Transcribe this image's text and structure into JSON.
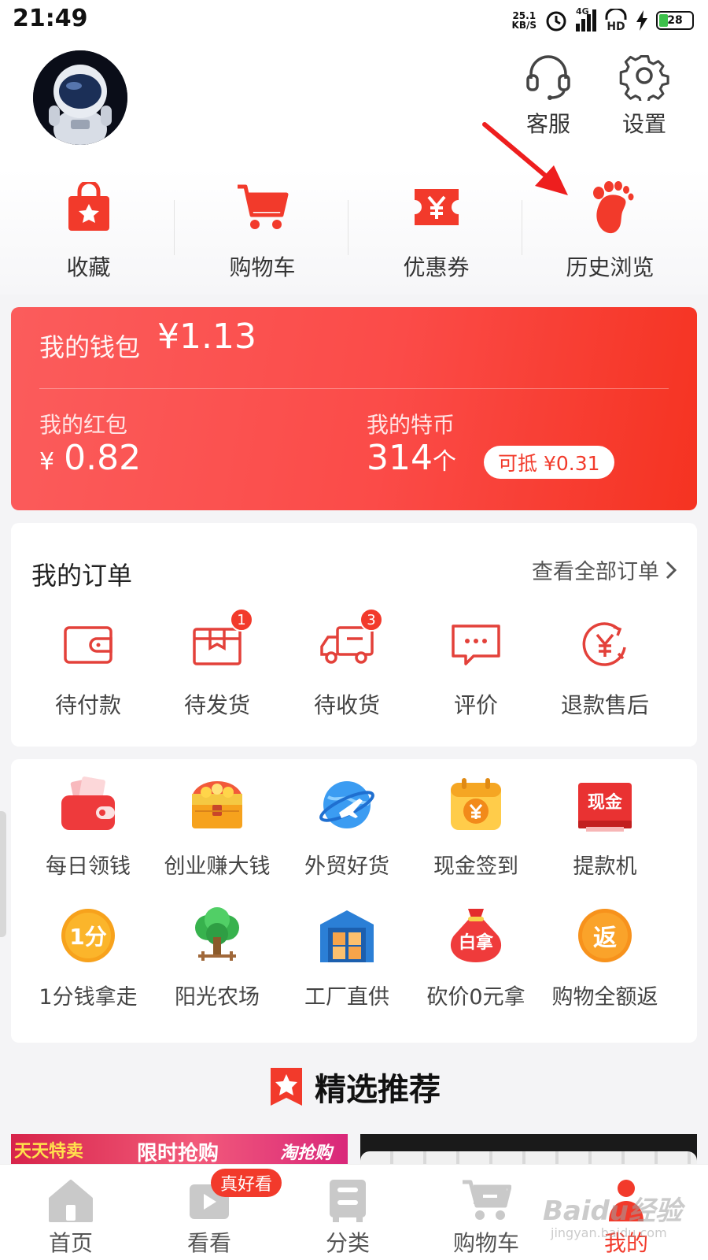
{
  "status_bar": {
    "time": "21:49",
    "net_speed_value": "25.1",
    "net_speed_unit": "KB/S",
    "network": "4G",
    "hd": "HD",
    "battery": "28",
    "battery_level": 0.28
  },
  "header": {
    "actions": [
      {
        "label": "客服",
        "icon": "headset-icon"
      },
      {
        "label": "设置",
        "icon": "gear-icon"
      }
    ]
  },
  "quick_links": [
    {
      "label": "收藏",
      "icon": "favorite-bag-icon"
    },
    {
      "label": "购物车",
      "icon": "cart-icon"
    },
    {
      "label": "优惠券",
      "icon": "coupon-icon"
    },
    {
      "label": "历史浏览",
      "icon": "footprint-icon"
    }
  ],
  "wallet": {
    "title": "我的钱包",
    "total": "¥1.13",
    "red_packet_label": "我的红包",
    "red_packet_currency": "¥",
    "red_packet_value": "0.82",
    "coin_label": "我的特币",
    "coin_value": "314",
    "coin_unit": "个",
    "coin_offset": "可抵 ¥0.31"
  },
  "orders": {
    "title": "我的订单",
    "view_all": "查看全部订单",
    "items": [
      {
        "label": "待付款",
        "icon": "wallet-icon",
        "badge": ""
      },
      {
        "label": "待发货",
        "icon": "package-icon",
        "badge": "1"
      },
      {
        "label": "待收货",
        "icon": "truck-icon",
        "badge": "3"
      },
      {
        "label": "评价",
        "icon": "comment-icon",
        "badge": ""
      },
      {
        "label": "退款售后",
        "icon": "refund-icon",
        "badge": ""
      }
    ]
  },
  "services": [
    {
      "label": "每日领钱",
      "icon": "red-wallet-icon"
    },
    {
      "label": "创业赚大钱",
      "icon": "treasure-chest-icon"
    },
    {
      "label": "外贸好货",
      "icon": "globe-plane-icon"
    },
    {
      "label": "现金签到",
      "icon": "calendar-coin-icon"
    },
    {
      "label": "提款机",
      "icon": "cash-machine-icon",
      "text": "现金"
    },
    {
      "label": "1分钱拿走",
      "icon": "one-cent-icon",
      "text": "1分"
    },
    {
      "label": "阳光农场",
      "icon": "tree-icon"
    },
    {
      "label": "工厂直供",
      "icon": "factory-icon"
    },
    {
      "label": "砍价0元拿",
      "icon": "money-bag-icon",
      "text": "白拿"
    },
    {
      "label": "购物全额返",
      "icon": "rebate-icon",
      "text": "返"
    }
  ],
  "recommend": {
    "title": "精选推荐",
    "banner_left": {
      "tag": "天天特卖",
      "headline": "限时抢购",
      "brand": "淘抢购"
    }
  },
  "tab_bar": {
    "items": [
      {
        "label": "首页",
        "icon": "home-icon"
      },
      {
        "label": "看看",
        "icon": "video-icon"
      },
      {
        "label": "分类",
        "icon": "category-icon"
      },
      {
        "label": "购物车",
        "icon": "cart-icon"
      },
      {
        "label": "我的",
        "icon": "profile-icon"
      }
    ],
    "active": "我的",
    "badge": "真好看"
  },
  "watermark": {
    "brand": "Baidu经验",
    "url": "jingyan.baidu.com"
  },
  "colors": {
    "accent": "#f23a2b",
    "wallet_start": "#fb5c5c",
    "wallet_end": "#f53321"
  }
}
